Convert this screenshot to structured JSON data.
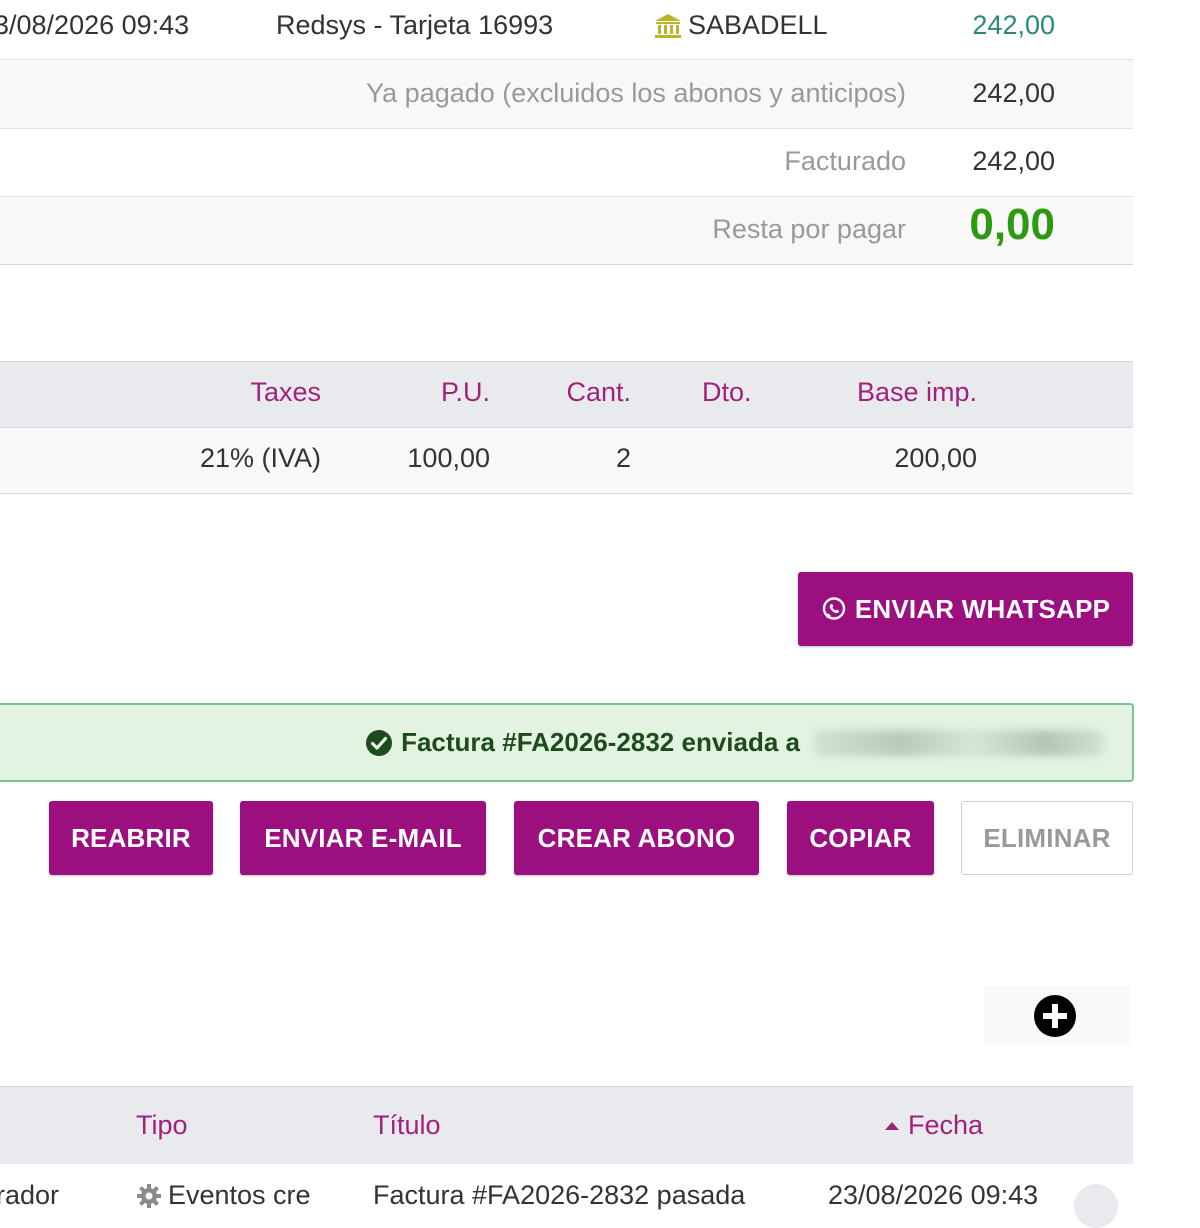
{
  "payments": {
    "date": "3/08/2026 09:43",
    "description": "Redsys - Tarjeta 16993",
    "bank": "SABADELL",
    "bank_icon": "bank-icon",
    "amount": "242,00"
  },
  "summary": {
    "paid_label": "Ya pagado (excluidos los abonos y anticipos)",
    "paid_value": "242,00",
    "invoiced_label": "Facturado",
    "invoiced_value": "242,00",
    "remaining_label": "Resta por pagar",
    "remaining_value": "0,00"
  },
  "lines": {
    "headers": {
      "taxes": "Taxes",
      "unit_price": "P.U.",
      "qty": "Cant.",
      "discount": "Dto.",
      "base": "Base imp."
    },
    "rows": [
      {
        "taxes": "21% (IVA)",
        "unit_price": "100,00",
        "qty": "2",
        "discount": "",
        "base": "200,00"
      }
    ]
  },
  "whatsapp_button": {
    "label": "ENVIAR WHATSAPP",
    "icon": "whatsapp-icon"
  },
  "alert": {
    "icon": "check-circle-icon",
    "text": "Factura #FA2026-2832 enviada a"
  },
  "actions": {
    "reopen": "REABRIR",
    "send_email": "ENVIAR E-MAIL",
    "create_credit": "CREAR ABONO",
    "copy": "COPIAR",
    "delete": "ELIMINAR"
  },
  "add_event": {
    "icon": "plus-circle-icon"
  },
  "events": {
    "headers": {
      "type": "Tipo",
      "title": "Título",
      "date": "Fecha",
      "sort_icon": "sort-up-icon"
    },
    "rows": [
      {
        "author": "rador",
        "type": "Eventos cre",
        "type_icon": "gear-icon",
        "title": "Factura #FA2026-2832 pasada",
        "date": "23/08/2026 09:43"
      }
    ]
  },
  "colors": {
    "accent": "#9b0f7f",
    "header_text": "#a2217d",
    "paid_amount": "#2a8a78",
    "remaining_zero": "#2d9a12",
    "alert_bg": "#e2f3e2",
    "alert_border": "#7cc58e"
  }
}
